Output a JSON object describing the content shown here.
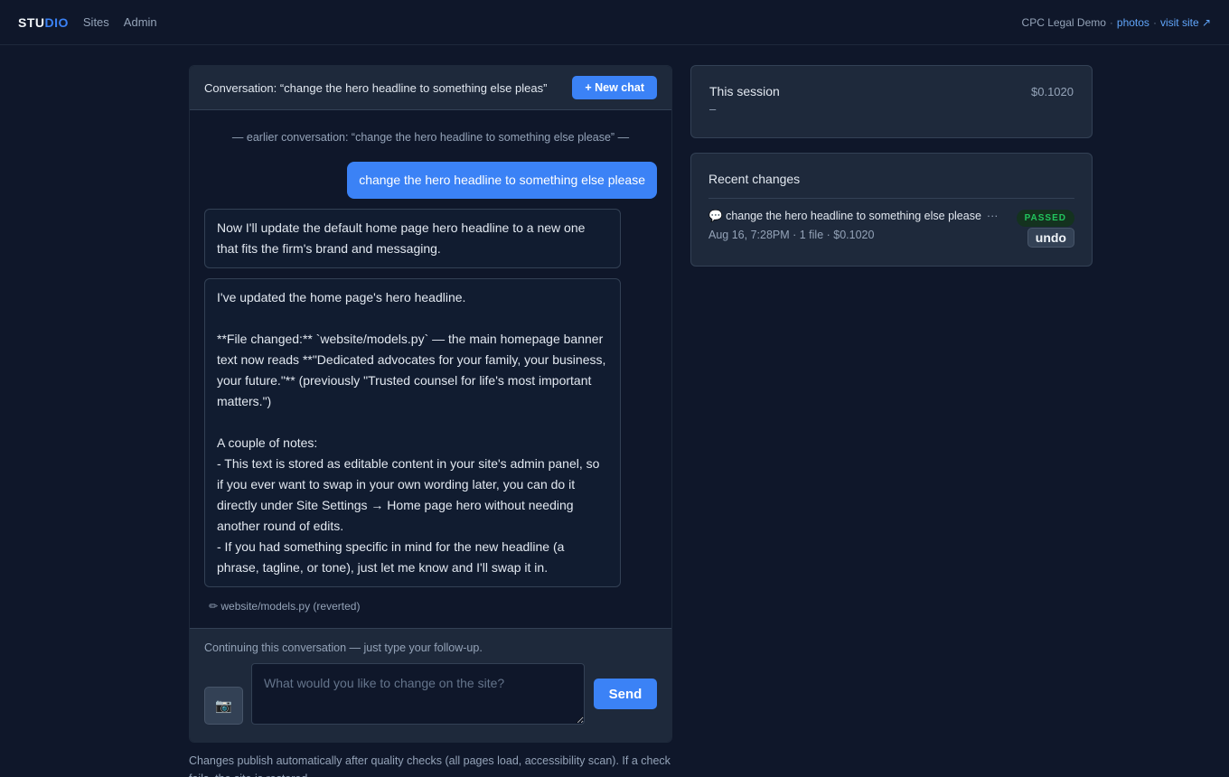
{
  "nav": {
    "brand_a": "STU",
    "brand_b": "DIO",
    "links": [
      "Sites",
      "Admin"
    ],
    "site_name": "CPC Legal Demo",
    "sep": "·",
    "photos": "photos",
    "visit": "visit site ↗"
  },
  "chat": {
    "title": "Conversation: “change the hero headline to something else pleas”",
    "new_chat": "+ New chat",
    "earlier": "— earlier conversation: “change the hero headline to something else please” —",
    "user_msg": "change the hero headline to something else please",
    "bot_msg_1": "Now I'll update the default home page hero headline to a new one that fits the firm's brand and messaging.",
    "bot_msg_2": "I've updated the home page's hero headline.\n\n**File changed:** `website/models.py` — the main homepage banner text now reads **\"Dedicated advocates for your family, your business, your future.\"** (previously \"Trusted counsel for life's most important matters.\")\n\nA couple of notes:\n- This text is stored as editable content in your site's admin panel, so if you ever want to swap in your own wording later, you can do it directly under Site Settings → Home page hero without needing another round of edits.\n- If you had something specific in mind for the new headline (a phrase, tagline, or tone), just let me know and I'll swap it in.",
    "file_note": "✏ website/models.py (reverted)",
    "foot_hint": "Continuing this conversation — just type your follow-up.",
    "camera": "📷",
    "placeholder": "What would you like to change on the site?",
    "send": "Send",
    "below_note": "Changes publish automatically after quality checks (all pages load, accessibility scan). If a check fails, the site is restored."
  },
  "session": {
    "label": "This session",
    "cost": "$0.1020",
    "sub": "–"
  },
  "changes": {
    "title": "Recent changes",
    "items": [
      {
        "icon": "💬",
        "text": "change the hero headline to something else please",
        "more": "···",
        "meta": "Aug 16, 7:28PM · 1 file · $0.1020",
        "status": "PASSED",
        "undo": "undo"
      }
    ]
  },
  "colors": {
    "accent": "#3b82f6",
    "passed": "#22c55e",
    "background": "#0f172a"
  }
}
